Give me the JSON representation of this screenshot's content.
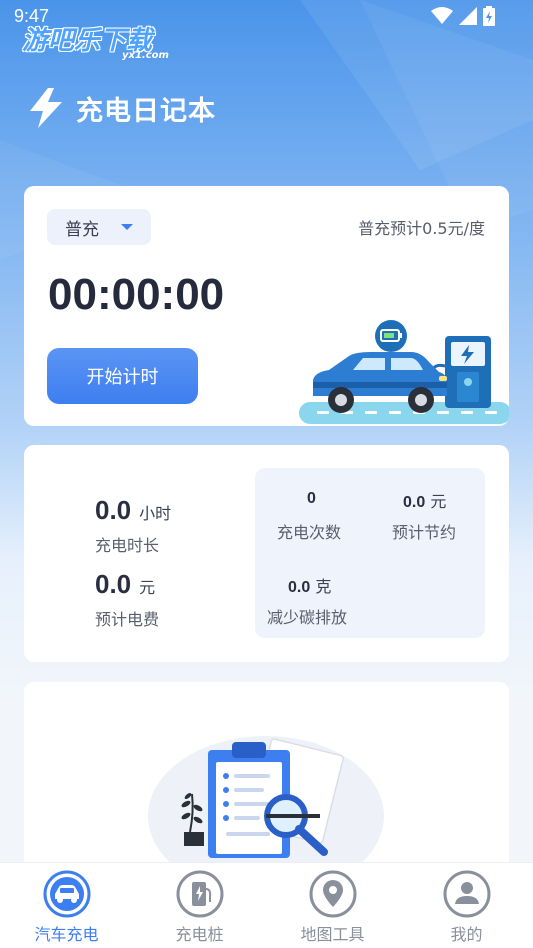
{
  "status_bar": {
    "time": "9:47"
  },
  "watermark": {
    "text": "游吧乐下载",
    "sub": "yx1.com"
  },
  "header": {
    "title": "充电日记本",
    "icon": "lightning-icon"
  },
  "timer_card": {
    "mode": "普充",
    "rate_text": "普充预计0.5元/度",
    "timer": "00:00:00",
    "start_button": "开始计时"
  },
  "stats": {
    "duration": {
      "value": "0.0",
      "unit": "小时",
      "label": "充电时长"
    },
    "cost": {
      "value": "0.0",
      "unit": "元",
      "label": "预计电费"
    },
    "count": {
      "value": "0",
      "label": "充电次数"
    },
    "saving": {
      "value": "0.0",
      "unit": "元",
      "label": "预计节约"
    },
    "carbon": {
      "value": "0.0",
      "unit": "克",
      "label": "减少碳排放"
    }
  },
  "tabs": [
    {
      "label": "汽车充电",
      "icon": "car-icon",
      "active": true
    },
    {
      "label": "充电桩",
      "icon": "charging-pile-icon",
      "active": false
    },
    {
      "label": "地图工具",
      "icon": "map-pin-icon",
      "active": false
    },
    {
      "label": "我的",
      "icon": "user-icon",
      "active": false
    }
  ],
  "colors": {
    "accent": "#3d7ff0",
    "header_bg": "#4a94ea",
    "text_dark": "#262a3d",
    "tab_inactive": "#8a8f9c"
  }
}
